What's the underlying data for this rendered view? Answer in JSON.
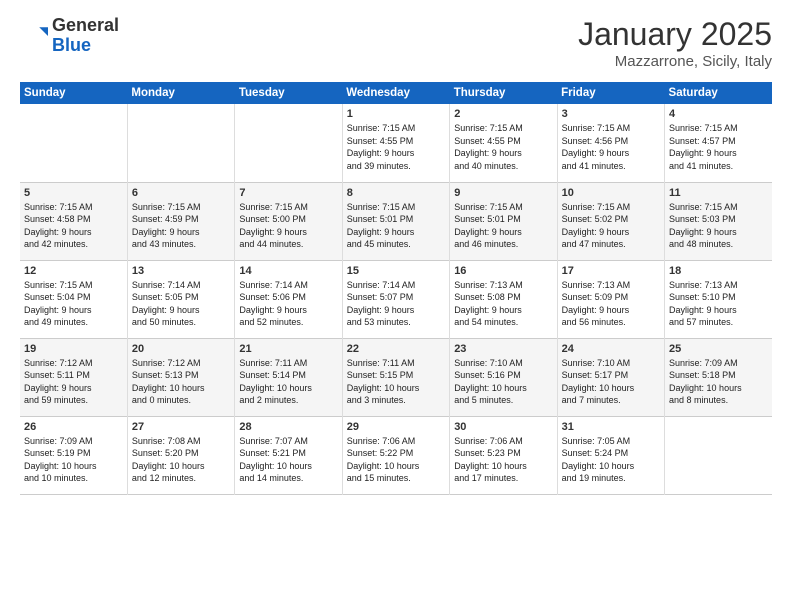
{
  "header": {
    "logo_general": "General",
    "logo_blue": "Blue",
    "month": "January 2025",
    "location": "Mazzarrone, Sicily, Italy"
  },
  "weekdays": [
    "Sunday",
    "Monday",
    "Tuesday",
    "Wednesday",
    "Thursday",
    "Friday",
    "Saturday"
  ],
  "weeks": [
    [
      {
        "day": "",
        "info": ""
      },
      {
        "day": "",
        "info": ""
      },
      {
        "day": "",
        "info": ""
      },
      {
        "day": "1",
        "info": "Sunrise: 7:15 AM\nSunset: 4:55 PM\nDaylight: 9 hours\nand 39 minutes."
      },
      {
        "day": "2",
        "info": "Sunrise: 7:15 AM\nSunset: 4:55 PM\nDaylight: 9 hours\nand 40 minutes."
      },
      {
        "day": "3",
        "info": "Sunrise: 7:15 AM\nSunset: 4:56 PM\nDaylight: 9 hours\nand 41 minutes."
      },
      {
        "day": "4",
        "info": "Sunrise: 7:15 AM\nSunset: 4:57 PM\nDaylight: 9 hours\nand 41 minutes."
      }
    ],
    [
      {
        "day": "5",
        "info": "Sunrise: 7:15 AM\nSunset: 4:58 PM\nDaylight: 9 hours\nand 42 minutes."
      },
      {
        "day": "6",
        "info": "Sunrise: 7:15 AM\nSunset: 4:59 PM\nDaylight: 9 hours\nand 43 minutes."
      },
      {
        "day": "7",
        "info": "Sunrise: 7:15 AM\nSunset: 5:00 PM\nDaylight: 9 hours\nand 44 minutes."
      },
      {
        "day": "8",
        "info": "Sunrise: 7:15 AM\nSunset: 5:01 PM\nDaylight: 9 hours\nand 45 minutes."
      },
      {
        "day": "9",
        "info": "Sunrise: 7:15 AM\nSunset: 5:01 PM\nDaylight: 9 hours\nand 46 minutes."
      },
      {
        "day": "10",
        "info": "Sunrise: 7:15 AM\nSunset: 5:02 PM\nDaylight: 9 hours\nand 47 minutes."
      },
      {
        "day": "11",
        "info": "Sunrise: 7:15 AM\nSunset: 5:03 PM\nDaylight: 9 hours\nand 48 minutes."
      }
    ],
    [
      {
        "day": "12",
        "info": "Sunrise: 7:15 AM\nSunset: 5:04 PM\nDaylight: 9 hours\nand 49 minutes."
      },
      {
        "day": "13",
        "info": "Sunrise: 7:14 AM\nSunset: 5:05 PM\nDaylight: 9 hours\nand 50 minutes."
      },
      {
        "day": "14",
        "info": "Sunrise: 7:14 AM\nSunset: 5:06 PM\nDaylight: 9 hours\nand 52 minutes."
      },
      {
        "day": "15",
        "info": "Sunrise: 7:14 AM\nSunset: 5:07 PM\nDaylight: 9 hours\nand 53 minutes."
      },
      {
        "day": "16",
        "info": "Sunrise: 7:13 AM\nSunset: 5:08 PM\nDaylight: 9 hours\nand 54 minutes."
      },
      {
        "day": "17",
        "info": "Sunrise: 7:13 AM\nSunset: 5:09 PM\nDaylight: 9 hours\nand 56 minutes."
      },
      {
        "day": "18",
        "info": "Sunrise: 7:13 AM\nSunset: 5:10 PM\nDaylight: 9 hours\nand 57 minutes."
      }
    ],
    [
      {
        "day": "19",
        "info": "Sunrise: 7:12 AM\nSunset: 5:11 PM\nDaylight: 9 hours\nand 59 minutes."
      },
      {
        "day": "20",
        "info": "Sunrise: 7:12 AM\nSunset: 5:13 PM\nDaylight: 10 hours\nand 0 minutes."
      },
      {
        "day": "21",
        "info": "Sunrise: 7:11 AM\nSunset: 5:14 PM\nDaylight: 10 hours\nand 2 minutes."
      },
      {
        "day": "22",
        "info": "Sunrise: 7:11 AM\nSunset: 5:15 PM\nDaylight: 10 hours\nand 3 minutes."
      },
      {
        "day": "23",
        "info": "Sunrise: 7:10 AM\nSunset: 5:16 PM\nDaylight: 10 hours\nand 5 minutes."
      },
      {
        "day": "24",
        "info": "Sunrise: 7:10 AM\nSunset: 5:17 PM\nDaylight: 10 hours\nand 7 minutes."
      },
      {
        "day": "25",
        "info": "Sunrise: 7:09 AM\nSunset: 5:18 PM\nDaylight: 10 hours\nand 8 minutes."
      }
    ],
    [
      {
        "day": "26",
        "info": "Sunrise: 7:09 AM\nSunset: 5:19 PM\nDaylight: 10 hours\nand 10 minutes."
      },
      {
        "day": "27",
        "info": "Sunrise: 7:08 AM\nSunset: 5:20 PM\nDaylight: 10 hours\nand 12 minutes."
      },
      {
        "day": "28",
        "info": "Sunrise: 7:07 AM\nSunset: 5:21 PM\nDaylight: 10 hours\nand 14 minutes."
      },
      {
        "day": "29",
        "info": "Sunrise: 7:06 AM\nSunset: 5:22 PM\nDaylight: 10 hours\nand 15 minutes."
      },
      {
        "day": "30",
        "info": "Sunrise: 7:06 AM\nSunset: 5:23 PM\nDaylight: 10 hours\nand 17 minutes."
      },
      {
        "day": "31",
        "info": "Sunrise: 7:05 AM\nSunset: 5:24 PM\nDaylight: 10 hours\nand 19 minutes."
      },
      {
        "day": "",
        "info": ""
      }
    ]
  ]
}
